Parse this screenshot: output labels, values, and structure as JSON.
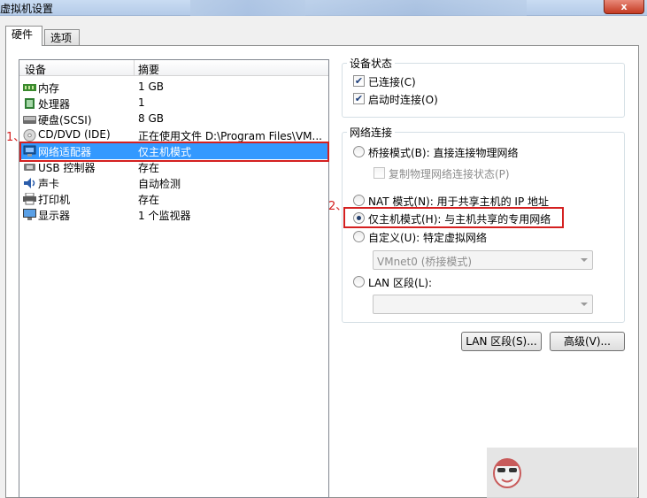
{
  "window": {
    "title": "虚拟机设置",
    "close_label": "x"
  },
  "tabs": [
    {
      "label": "硬件"
    },
    {
      "label": "选项"
    }
  ],
  "device_list": {
    "columns": [
      "设备",
      "摘要"
    ],
    "rows": [
      {
        "name": "内存",
        "summary": "1 GB",
        "icon": "memory-icon"
      },
      {
        "name": "处理器",
        "summary": "1",
        "icon": "processor-icon"
      },
      {
        "name": "硬盘(SCSI)",
        "summary": "8 GB",
        "icon": "harddisk-icon"
      },
      {
        "name": "CD/DVD (IDE)",
        "summary": "正在使用文件 D:\\Program Files\\VM...",
        "icon": "cd-icon"
      },
      {
        "name": "网络适配器",
        "summary": "仅主机模式",
        "icon": "network-adapter-icon"
      },
      {
        "name": "USB 控制器",
        "summary": "存在",
        "icon": "usb-icon"
      },
      {
        "name": "声卡",
        "summary": "自动检测",
        "icon": "sound-icon"
      },
      {
        "name": "打印机",
        "summary": "存在",
        "icon": "printer-icon"
      },
      {
        "name": "显示器",
        "summary": "1 个监视器",
        "icon": "display-icon"
      }
    ],
    "selected_index": 4
  },
  "annotations": {
    "marker1": "1、",
    "marker2": "2、",
    "accent": "#d42020"
  },
  "device_status": {
    "title": "设备状态",
    "connected": {
      "label": "已连接(C)",
      "checked": true
    },
    "connect_on_start": {
      "label": "启动时连接(O)",
      "checked": true
    }
  },
  "network": {
    "title": "网络连接",
    "bridged": {
      "label": "桥接模式(B): 直接连接物理网络",
      "selected": false
    },
    "replicate": {
      "label": "复制物理网络连接状态(P)",
      "checked": false,
      "disabled": true
    },
    "nat": {
      "label": "NAT 模式(N): 用于共享主机的 IP 地址",
      "selected": false
    },
    "host_only": {
      "label": "仅主机模式(H): 与主机共享的专用网络",
      "selected": true
    },
    "custom": {
      "label": "自定义(U): 特定虚拟网络",
      "selected": false
    },
    "custom_combo": {
      "value": "VMnet0 (桥接模式)"
    },
    "lan_segment": {
      "label": "LAN 区段(L):",
      "selected": false
    },
    "lan_combo": {
      "value": ""
    }
  },
  "buttons": {
    "lan_segments": "LAN 区段(S)...",
    "advanced": "高级(V)..."
  },
  "colors": {
    "selection": "#3399ff",
    "highlight_box": "#d42020"
  }
}
